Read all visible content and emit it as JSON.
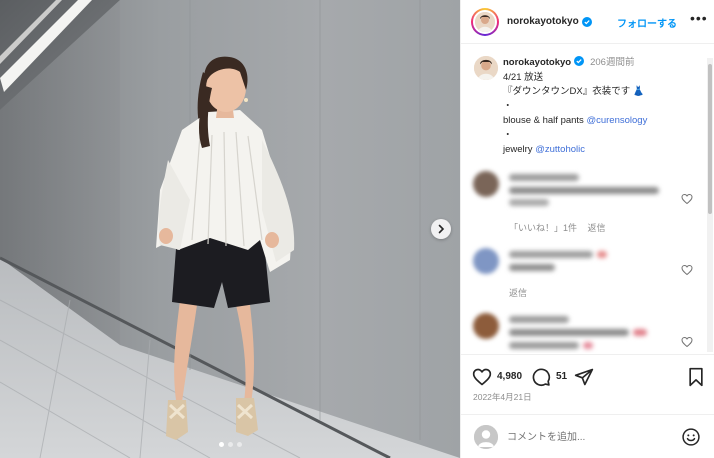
{
  "post": {
    "username": "norokayotokyo",
    "follow_label": "フォローする",
    "more_label": "•••",
    "caption": {
      "username": "norokayotokyo",
      "time_ago": "206週間前",
      "line1": "4/21 放送",
      "line2": "『ダウンタウンDX』衣装です",
      "line2_emoji": "👗",
      "bullet": "・",
      "line3_prefix": "blouse & half pants ",
      "line3_mention": "@curensology",
      "line4_prefix": "jewelry ",
      "line4_mention": "@zuttoholic"
    },
    "comments": [
      {
        "meta_likes": "「いいね！」1件",
        "meta_reply": "返信",
        "avatar_color": "#7a6558"
      },
      {
        "meta_likes": "",
        "meta_reply": "返信",
        "avatar_color": "#7f96c4"
      },
      {
        "meta_likes": "",
        "meta_reply": "",
        "avatar_color": "#8d5c3b"
      }
    ],
    "likes_count": "4,980",
    "comments_count": "51",
    "date": "2022年4月21日",
    "add_comment_placeholder": "コメントを追加...",
    "carousel": {
      "total": 3,
      "active_index": 0
    }
  },
  "colors": {
    "accent": "#0095f6",
    "mention": "#3f6fd8",
    "verified": "#0095f6",
    "muted": "#8e8e8e"
  },
  "icons": [
    "verified-badge-icon",
    "more-icon",
    "heart-icon",
    "comment-icon",
    "share-icon",
    "save-icon",
    "emoji-icon",
    "chevron-right-icon",
    "user-icon"
  ]
}
